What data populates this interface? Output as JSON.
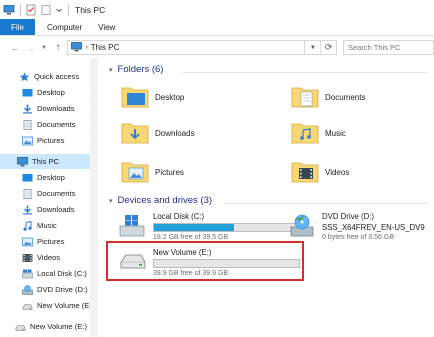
{
  "window": {
    "title": "This PC"
  },
  "ribbon": {
    "tabs": [
      "File",
      "Computer",
      "View"
    ]
  },
  "address": {
    "crumb": "This PC",
    "search_placeholder": "Search This PC"
  },
  "navpane": {
    "items": [
      {
        "label": "Quick access",
        "icon": "star-icon"
      },
      {
        "label": "Desktop",
        "icon": "desktop-icon",
        "pinned": true
      },
      {
        "label": "Downloads",
        "icon": "downloads-icon",
        "pinned": true
      },
      {
        "label": "Documents",
        "icon": "documents-icon",
        "pinned": true
      },
      {
        "label": "Pictures",
        "icon": "pictures-icon",
        "pinned": true
      },
      {
        "label": "This PC",
        "icon": "computer-icon"
      },
      {
        "label": "Desktop",
        "icon": "desktop-icon"
      },
      {
        "label": "Documents",
        "icon": "documents-icon"
      },
      {
        "label": "Downloads",
        "icon": "downloads-icon"
      },
      {
        "label": "Music",
        "icon": "music-icon"
      },
      {
        "label": "Pictures",
        "icon": "pictures-icon"
      },
      {
        "label": "Videos",
        "icon": "videos-icon"
      },
      {
        "label": "Local Disk (C:)",
        "icon": "drive-icon"
      },
      {
        "label": "DVD Drive (D:) SS",
        "icon": "dvd-icon"
      },
      {
        "label": "New Volume (E:)",
        "icon": "removable-drive-icon"
      },
      {
        "label": "New Volume (E:)",
        "icon": "removable-drive-icon"
      }
    ]
  },
  "content": {
    "folders_header": "Folders (6)",
    "folders": [
      {
        "label": "Desktop"
      },
      {
        "label": "Documents"
      },
      {
        "label": "Downloads"
      },
      {
        "label": "Music"
      },
      {
        "label": "Pictures"
      },
      {
        "label": "Videos"
      }
    ],
    "drives_header": "Devices and drives (3)",
    "drives": [
      {
        "name": "Local Disk (C:)",
        "free": "18.2 GB free of 39.5 GB",
        "used_fraction": 0.54
      },
      {
        "name": "DVD Drive (D:)",
        "subname": "SSS_X64FREV_EN-US_DV9",
        "free": "0 bytes free of 3.56 GB"
      },
      {
        "name": "New Volume (E:)",
        "free": "39.9 GB free of 39.9 GB",
        "used_fraction": 0.0
      }
    ]
  },
  "colors": {
    "accent": "#1979ca",
    "selection": "#cce8ff",
    "progress": "#26a0da",
    "highlight": "#d32f2f",
    "header_text": "#1e3287"
  }
}
